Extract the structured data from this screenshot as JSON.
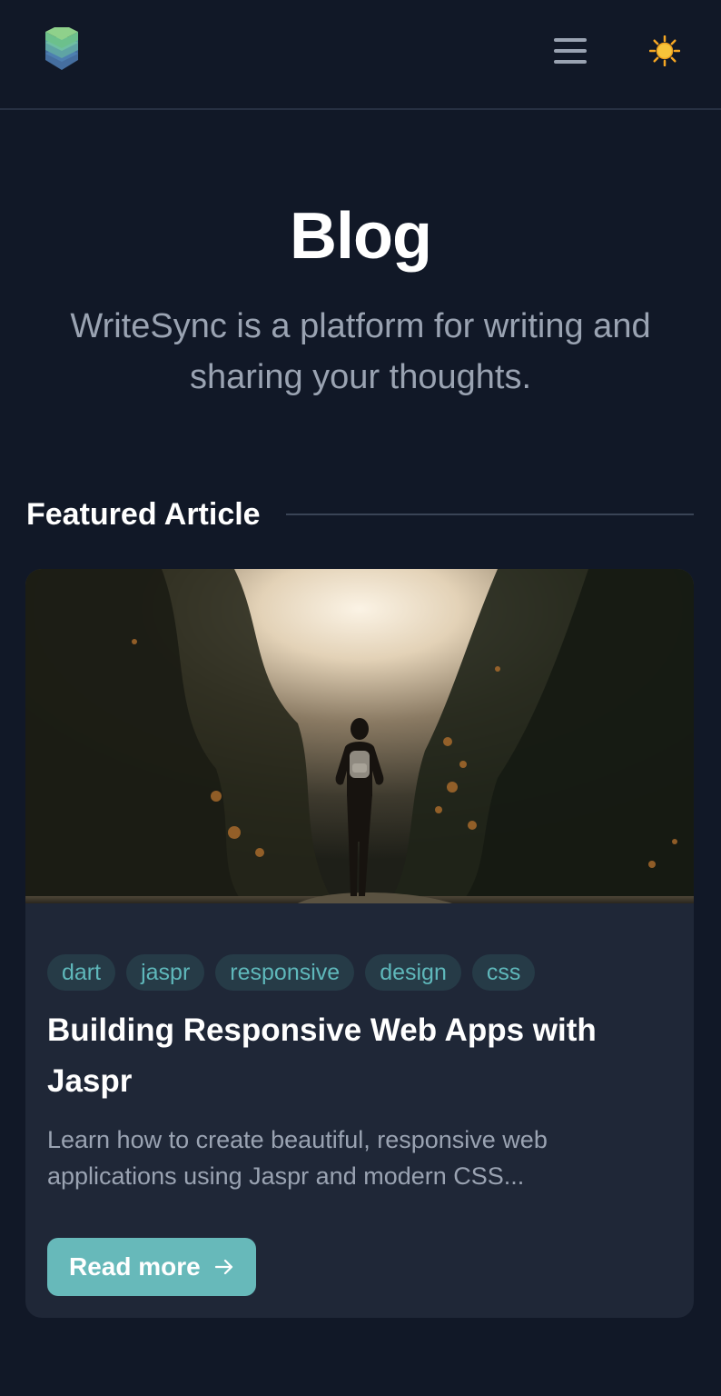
{
  "header": {
    "logo_icon": "stacked-layers-logo-icon",
    "menu_icon": "hamburger-menu-icon",
    "theme_icon": "sun-icon"
  },
  "hero": {
    "title": "Blog",
    "subtitle": "WriteSync is a platform for writing and sharing your thoughts."
  },
  "featured": {
    "heading": "Featured Article",
    "image_description_icon": "article-cover-image",
    "tags": [
      "dart",
      "jaspr",
      "responsive",
      "design",
      "css"
    ],
    "title": "Building Responsive Web Apps with Jaspr",
    "excerpt": "Learn how to create beautiful, responsive web applications using Jaspr and modern CSS...",
    "read_more_label": "Read more",
    "read_more_icon": "arrow-right-icon"
  },
  "colors": {
    "background": "#111827",
    "card_background": "#1f2737",
    "accent": "#67b9ba",
    "tag_background": "#263b47",
    "tag_text": "#5fb8bb",
    "muted_text": "#9aa3b2"
  }
}
